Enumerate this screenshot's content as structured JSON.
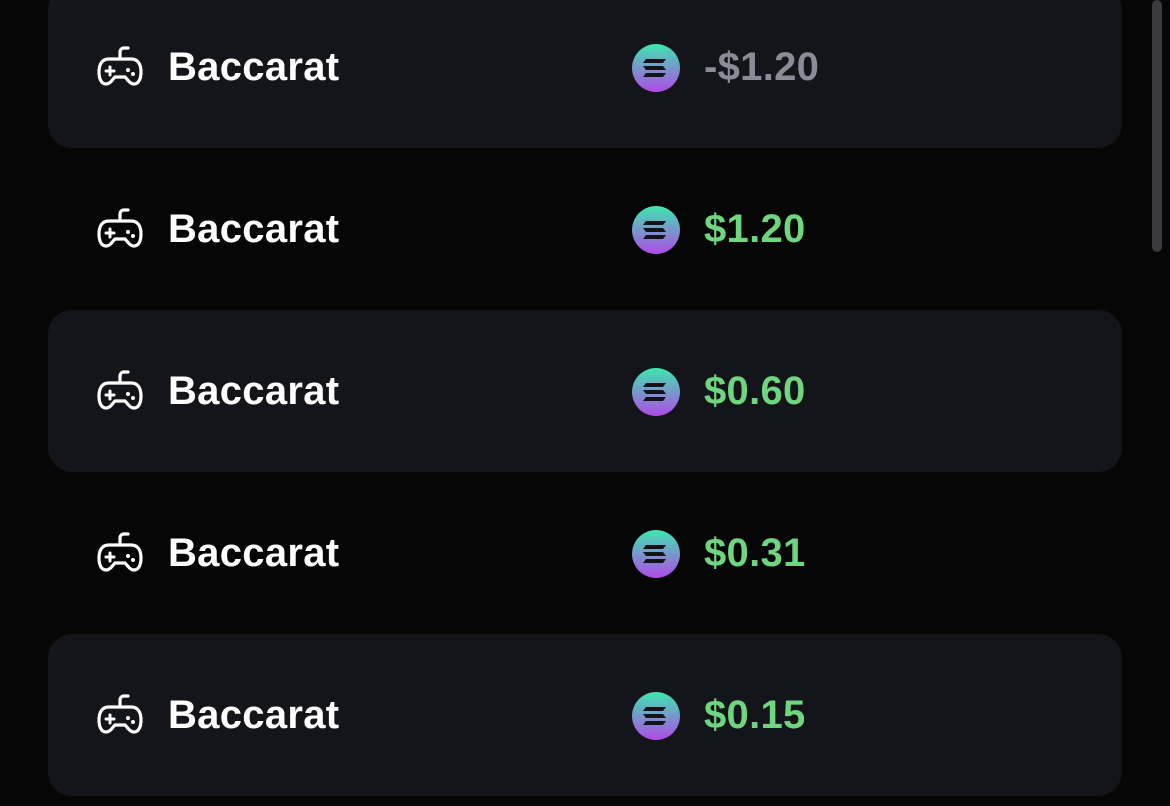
{
  "colors": {
    "background": "#060607",
    "row_shaded": "#14151a",
    "positive_amount": "#6fd67f",
    "negative_amount": "#8a8d98",
    "coin_gradient_top": "#3ee6b0",
    "coin_gradient_bottom": "#b04ae8"
  },
  "rows": [
    {
      "icon": "gamepad-icon",
      "game": "Baccarat",
      "coin_icon": "solana-coin-icon",
      "amount": "-$1.20",
      "sign": "negative",
      "shaded": true
    },
    {
      "icon": "gamepad-icon",
      "game": "Baccarat",
      "coin_icon": "solana-coin-icon",
      "amount": "$1.20",
      "sign": "positive",
      "shaded": false
    },
    {
      "icon": "gamepad-icon",
      "game": "Baccarat",
      "coin_icon": "solana-coin-icon",
      "amount": "$0.60",
      "sign": "positive",
      "shaded": true
    },
    {
      "icon": "gamepad-icon",
      "game": "Baccarat",
      "coin_icon": "solana-coin-icon",
      "amount": "$0.31",
      "sign": "positive",
      "shaded": false
    },
    {
      "icon": "gamepad-icon",
      "game": "Baccarat",
      "coin_icon": "solana-coin-icon",
      "amount": "$0.15",
      "sign": "positive",
      "shaded": true
    }
  ]
}
